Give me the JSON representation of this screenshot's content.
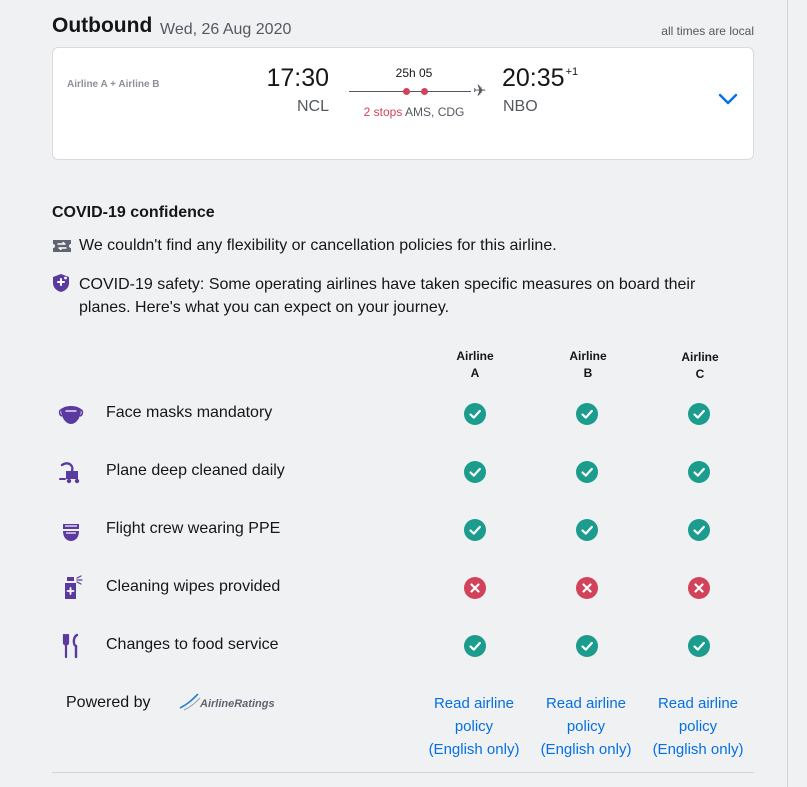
{
  "header": {
    "title": "Outbound",
    "date": "Wed, 26 Aug 2020",
    "timezone_note": "all times are local"
  },
  "flight": {
    "airlines": "Airline A + Airline B",
    "departure_time": "17:30",
    "departure_code": "NCL",
    "duration": "25h 05",
    "stops_label": "2 stops",
    "stops_airports": "AMS, CDG",
    "arrival_time": "20:35",
    "arrival_day_offset": "+1",
    "arrival_code": "NBO",
    "expand_icon": "chevron-down-icon"
  },
  "covid": {
    "title": "COVID-19 confidence",
    "policy_text": "We couldn't find any flexibility or cancellation policies for this airline.",
    "safety_text": "COVID-19 safety: Some operating airlines have taken specific measures on board their planes. Here's what you can expect on your journey.",
    "columns": [
      {
        "line1": "Airline",
        "line2": "A"
      },
      {
        "line1": "Airline",
        "line2": "B"
      },
      {
        "line1": "Airline",
        "line2": "C"
      }
    ],
    "rows": [
      {
        "label": "Face masks mandatory",
        "icon": "face-mask-icon",
        "status": [
          "yes",
          "yes",
          "yes"
        ]
      },
      {
        "label": "Plane deep cleaned daily",
        "icon": "vacuum-icon",
        "status": [
          "yes",
          "yes",
          "yes"
        ]
      },
      {
        "label": "Flight crew wearing PPE",
        "icon": "ppe-icon",
        "status": [
          "yes",
          "yes",
          "yes"
        ]
      },
      {
        "label": "Cleaning wipes provided",
        "icon": "spray-bottle-icon",
        "status": [
          "no",
          "no",
          "no"
        ]
      },
      {
        "label": "Changes to food service",
        "icon": "cutlery-icon",
        "status": [
          "yes",
          "yes",
          "yes"
        ]
      }
    ],
    "powered_by": "Powered by",
    "powered_logo_text": "AirlineRatings",
    "read_policy": {
      "line1": "Read airline",
      "line2": "policy",
      "line3": "(English only)"
    }
  },
  "colors": {
    "accent": "#0770e3",
    "ok": "#1c9c8c",
    "no": "#d1435b",
    "icon": "#5b3aa0"
  }
}
